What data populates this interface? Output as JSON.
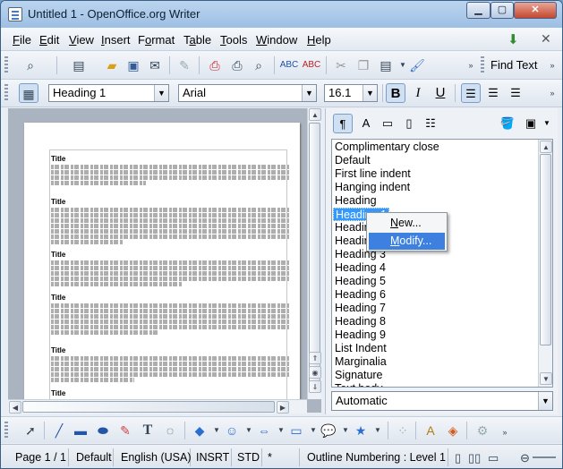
{
  "window": {
    "title": "Untitled 1 - OpenOffice.org Writer",
    "minimize_label": "▁",
    "maximize_label": "▢",
    "close_label": "✕"
  },
  "menubar": {
    "items": [
      "File",
      "Edit",
      "View",
      "Insert",
      "Format",
      "Table",
      "Tools",
      "Window",
      "Help"
    ],
    "mnemonics": [
      "F",
      "E",
      "V",
      "I",
      "o",
      "a",
      "T",
      "W",
      "H"
    ]
  },
  "standard_toolbar": {
    "find_text_label": "Find Text"
  },
  "formatting_toolbar": {
    "paragraph_style": "Heading 1",
    "font_name": "Arial",
    "font_size": "16.1",
    "bold_label": "B",
    "italic_label": "I",
    "underline_label": "U"
  },
  "document": {
    "sections": [
      "Title",
      "Title",
      "Title",
      "Title",
      "Title",
      "Title"
    ]
  },
  "styles_panel": {
    "items": [
      "Complimentary close",
      "Default",
      "First line indent",
      "Hanging indent",
      "Heading",
      "Heading 1",
      "Heading 10",
      "Heading 2",
      "Heading 3",
      "Heading 4",
      "Heading 5",
      "Heading 6",
      "Heading 7",
      "Heading 8",
      "Heading 9",
      "List Indent",
      "Marginalia",
      "Signature",
      "Text body"
    ],
    "selected_index": 5,
    "filter_value": "Automatic"
  },
  "context_menu": {
    "items": [
      {
        "label": "New...",
        "mnemonic": "N"
      },
      {
        "label": "Modify...",
        "mnemonic": "M"
      }
    ],
    "highlighted_index": 1
  },
  "statusbar": {
    "page": "Page 1 / 1",
    "page_style": "Default",
    "language": "English (USA)",
    "insert_mode": "INSRT",
    "selection_mode": "STD",
    "modified": "*",
    "outline": "Outline Numbering : Level 1"
  }
}
